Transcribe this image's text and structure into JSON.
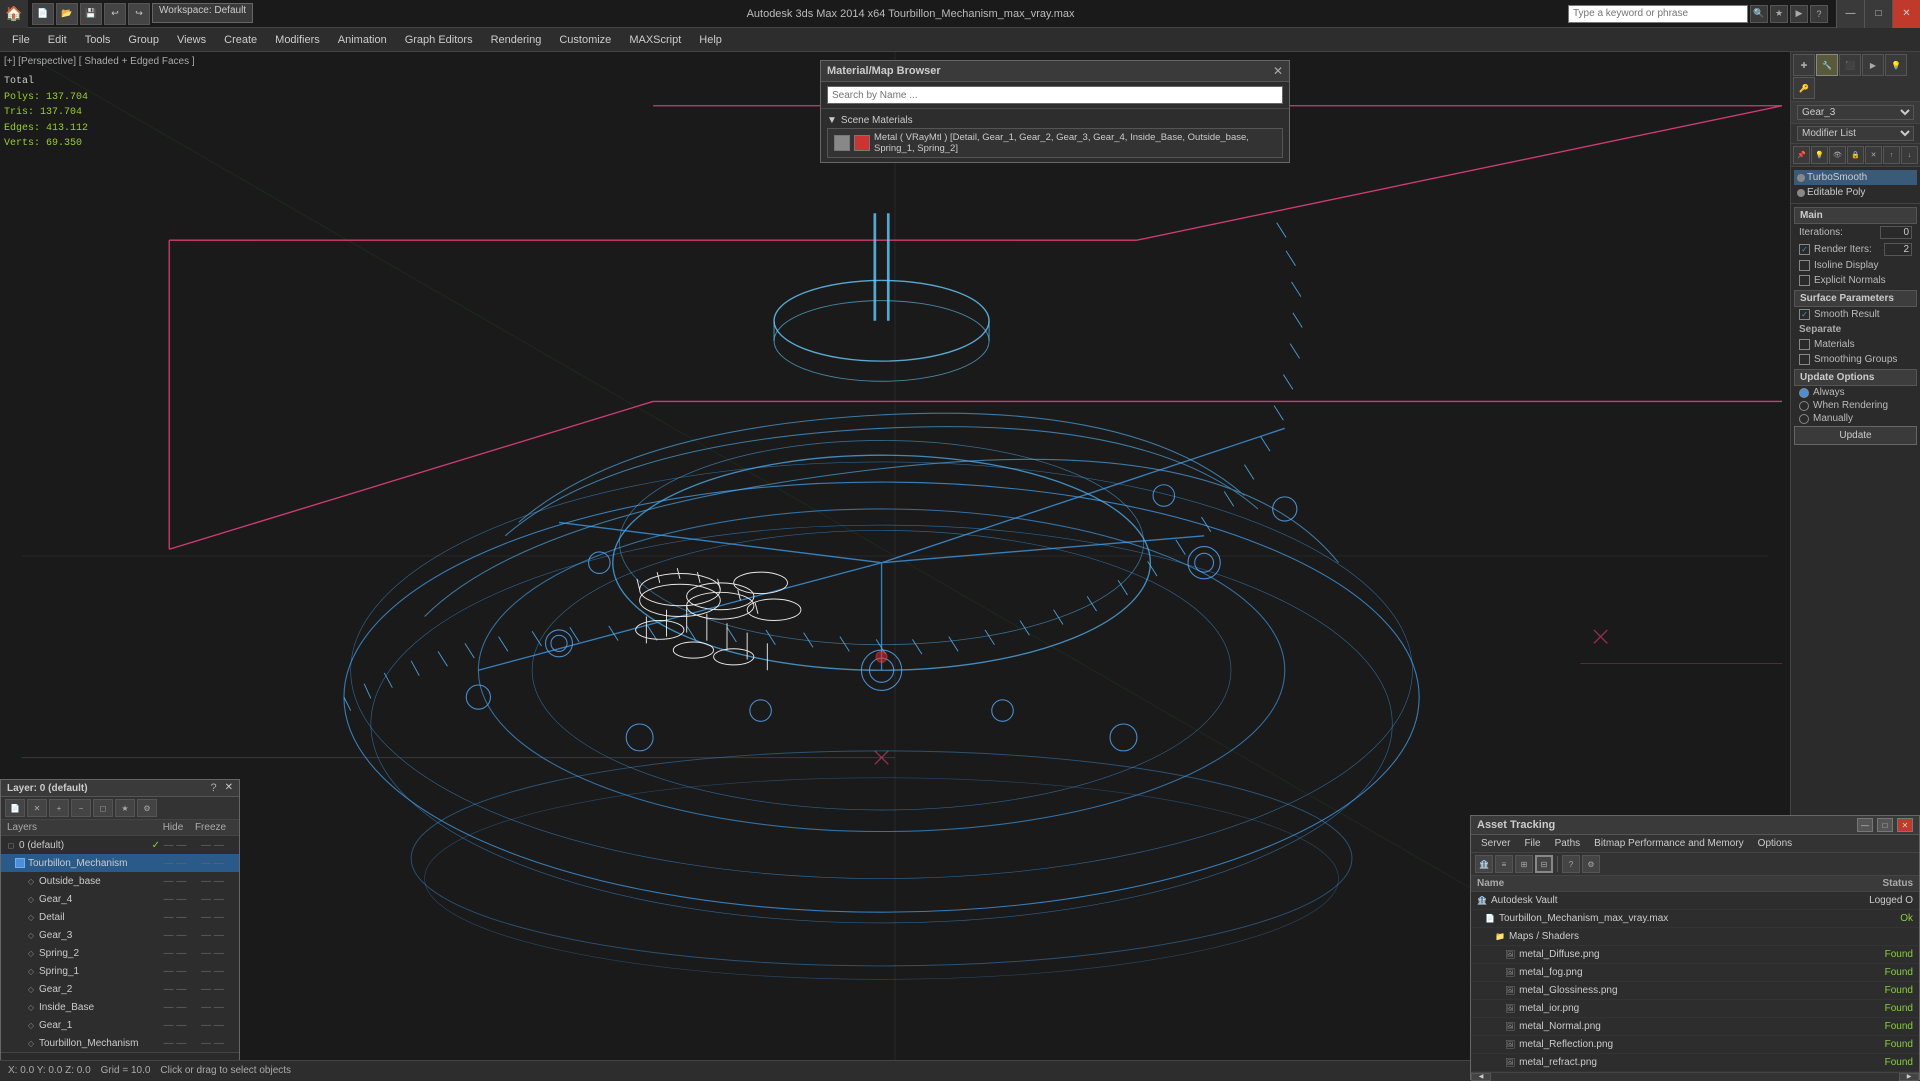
{
  "app": {
    "title": "Autodesk 3ds Max 2014 x64    Tourbillon_Mechanism_max_vray.max",
    "workspace": "Workspace: Default"
  },
  "titlebar": {
    "app_name": "3ds Max",
    "min_label": "—",
    "max_label": "□",
    "close_label": "✕"
  },
  "menu": {
    "items": [
      "File",
      "Edit",
      "Tools",
      "Group",
      "Views",
      "Create",
      "Modifiers",
      "Animation",
      "Graph Editors",
      "Rendering",
      "Customize",
      "MAXScript",
      "Help"
    ]
  },
  "viewport": {
    "label": "[+] [Perspective] [ Shaded + Edged Faces ]",
    "stats": {
      "polys_label": "Polys:",
      "polys_val": "137.704",
      "tris_label": "Tris:",
      "tris_val": "137.704",
      "edges_label": "Edges:",
      "edges_val": "413.112",
      "verts_label": "Verts:",
      "verts_val": "69.350"
    }
  },
  "material_browser": {
    "title": "Material/Map Browser",
    "search_placeholder": "Search by Name ...",
    "section_label": "Scene Materials",
    "material_name": "Metal ( VRayMtl ) [Detail, Gear_1, Gear_2, Gear_3, Gear_4, Inside_Base, Outside_base, Spring_1, Spring_2]"
  },
  "layers_panel": {
    "title": "Layer: 0 (default)",
    "help_label": "?",
    "close_label": "✕",
    "col_layers": "Layers",
    "col_hide": "Hide",
    "col_freeze": "Freeze",
    "rows": [
      {
        "indent": 0,
        "name": "0 (default)",
        "check": true,
        "dots1": "— — —",
        "dots2": "— — — —"
      },
      {
        "indent": 1,
        "name": "Tourbillon_Mechanism",
        "check": false,
        "dots1": "— — —",
        "dots2": "— — — —",
        "selected": true
      },
      {
        "indent": 2,
        "name": "Outside_base",
        "dots1": "— — —",
        "dots2": "— — — —"
      },
      {
        "indent": 2,
        "name": "Gear_4",
        "dots1": "— — —",
        "dots2": "— — — —"
      },
      {
        "indent": 2,
        "name": "Detail",
        "dots1": "— — —",
        "dots2": "— — — —"
      },
      {
        "indent": 2,
        "name": "Gear_3",
        "dots1": "— — —",
        "dots2": "— — — —"
      },
      {
        "indent": 2,
        "name": "Spring_2",
        "dots1": "— — —",
        "dots2": "— — — —"
      },
      {
        "indent": 2,
        "name": "Spring_1",
        "dots1": "— — —",
        "dots2": "— — — —"
      },
      {
        "indent": 2,
        "name": "Gear_2",
        "dots1": "— — —",
        "dots2": "— — — —"
      },
      {
        "indent": 2,
        "name": "Inside_Base",
        "dots1": "— — —",
        "dots2": "— — — —"
      },
      {
        "indent": 2,
        "name": "Gear_1",
        "dots1": "— — —",
        "dots2": "— — — —"
      },
      {
        "indent": 2,
        "name": "Tourbillon_Mechanism",
        "dots1": "— — —",
        "dots2": "— — — —"
      }
    ]
  },
  "right_sidebar": {
    "object_name": "Gear_3",
    "modifier_list_label": "Modifier List",
    "modifiers": [
      {
        "name": "TurboSmooth",
        "active": true
      },
      {
        "name": "Editable Poly",
        "active": false
      }
    ],
    "turbosmooth": {
      "section_main": "Main",
      "iter_label": "Iterations:",
      "iter_val": "0",
      "render_iters_label": "Render Iters:",
      "render_iters_val": "2",
      "isoline_label": "Isoline Display",
      "explicit_label": "Explicit Normals",
      "section_surface": "Surface Parameters",
      "smooth_result_label": "Smooth Result",
      "smooth_result_checked": true,
      "section_separate": "Separate",
      "materials_label": "Materials",
      "smoothing_label": "Smoothing Groups",
      "section_update": "Update Options",
      "always_label": "Always",
      "when_rendering_label": "When Rendering",
      "manually_label": "Manually",
      "update_btn": "Update"
    }
  },
  "asset_panel": {
    "title": "Asset Tracking",
    "menu": [
      "Server",
      "File",
      "Paths",
      "Bitmap Performance and Memory",
      "Options"
    ],
    "col_name": "Name",
    "col_status": "Status",
    "rows": [
      {
        "indent": 0,
        "name": "Autodesk Vault",
        "status": "Logged O",
        "icon": "vault"
      },
      {
        "indent": 1,
        "name": "Tourbillon_Mechanism_max_vray.max",
        "status": "Ok",
        "icon": "file"
      },
      {
        "indent": 2,
        "name": "Maps / Shaders",
        "status": "",
        "icon": "folder"
      },
      {
        "indent": 3,
        "name": "metal_Diffuse.png",
        "status": "Found",
        "icon": "image"
      },
      {
        "indent": 3,
        "name": "metal_fog.png",
        "status": "Found",
        "icon": "image"
      },
      {
        "indent": 3,
        "name": "metal_Glossiness.png",
        "status": "Found",
        "icon": "image"
      },
      {
        "indent": 3,
        "name": "metal_ior.png",
        "status": "Found",
        "icon": "image"
      },
      {
        "indent": 3,
        "name": "metal_Normal.png",
        "status": "Found",
        "icon": "image"
      },
      {
        "indent": 3,
        "name": "metal_Reflection.png",
        "status": "Found",
        "icon": "image"
      },
      {
        "indent": 3,
        "name": "metal_refract.png",
        "status": "Found",
        "icon": "image"
      }
    ]
  },
  "search": {
    "placeholder": "Type a keyword or phrase"
  },
  "status": {
    "total_label": "Total"
  }
}
